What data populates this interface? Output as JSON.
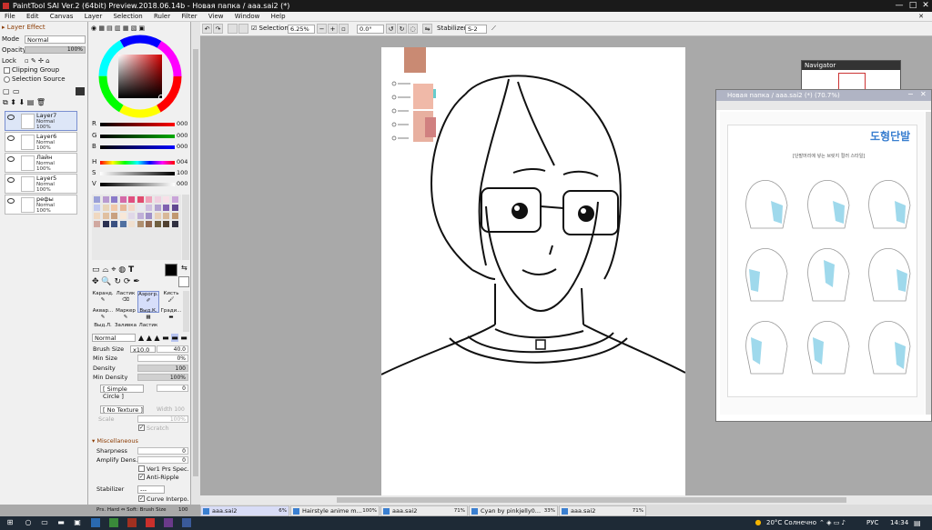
{
  "app": {
    "title": "PaintTool SAI Ver.2 (64bit) Preview.2018.06.14b - Новая папка / aaa.sai2 (*)",
    "window_buttons": [
      "—",
      "□",
      "✕"
    ]
  },
  "menu": [
    "File",
    "Edit",
    "Canvas",
    "Layer",
    "Selection",
    "Ruler",
    "Filter",
    "View",
    "Window",
    "Help"
  ],
  "layer_panel": {
    "header": "Layer Effect",
    "mode_label": "Mode",
    "mode_value": "Normal",
    "opacity_label": "Opacity",
    "opacity_value": "100%",
    "lock_label": "Lock",
    "clipping_group": "Clipping Group",
    "selection_source": "Selection Source",
    "layers": [
      {
        "name": "Layer7",
        "mode": "Normal",
        "opacity": "100%",
        "selected": true
      },
      {
        "name": "Layer6",
        "mode": "Normal",
        "opacity": "100%",
        "selected": false
      },
      {
        "name": "Лайн",
        "mode": "Normal",
        "opacity": "100%",
        "selected": false
      },
      {
        "name": "Layer5",
        "mode": "Normal",
        "opacity": "100%",
        "selected": false
      },
      {
        "name": "рефы",
        "mode": "Normal",
        "opacity": "100%",
        "selected": false
      }
    ]
  },
  "color_panel": {
    "rgb": [
      {
        "label": "R",
        "value": "000"
      },
      {
        "label": "G",
        "value": "000"
      },
      {
        "label": "B",
        "value": "000"
      }
    ],
    "hsv": [
      {
        "label": "H",
        "value": "004"
      },
      {
        "label": "S",
        "value": "100"
      },
      {
        "label": "V",
        "value": "000"
      }
    ],
    "current_color": "#000000",
    "swatches": [
      "#9aa0d8",
      "#b89ad0",
      "#8a7ac8",
      "#d46aa8",
      "#e05080",
      "#e04b6e",
      "#f0a0b8",
      "#f0d0e0",
      "#f8e0e8",
      "#c9a4d9",
      "#c0c8f0",
      "#e8d4b8",
      "#f0c8a8",
      "#e8b898",
      "#f4d8c8",
      "#e8e8f0",
      "#d0c0e0",
      "#b0a0d0",
      "#8060b0",
      "#604890",
      "#f0d8c0",
      "#e0c0a0",
      "#c8a080",
      "#f8e8d8",
      "#e0d8e8",
      "#c0b0d8",
      "#a090c8",
      "#e8d0b8",
      "#d8b898",
      "#c09870",
      "#d0a8a0",
      "#2a3050",
      "#3a5080",
      "#5070a0",
      "#f0e0d0",
      "#b09070",
      "#906850",
      "#706040",
      "#504030",
      "#303040"
    ]
  },
  "tools": {
    "brushes": [
      "Каранд.",
      "Ластик",
      "Аэрогр.",
      "Кисть",
      "Аквар...",
      "Маркер",
      "Выд.К.",
      "Гради...",
      "Выд.Л.",
      "Заливка",
      "Ластик"
    ],
    "selected_brush": "Аэрогр.",
    "blend_mode": "Normal",
    "brush_size_label": "Brush Size",
    "brush_size_mult": "x10.0",
    "brush_size_value": "40.0",
    "min_size_label": "Min Size",
    "min_size_value": "0%",
    "density_label": "Density",
    "density_value": "100",
    "min_density_label": "Min Density",
    "min_density_value": "100%",
    "shape": "[ Simple Circle ]",
    "shape_value": "0",
    "texture": "[ No Texture ]",
    "texture_width": "Width 100",
    "scale_label": "Scale",
    "scale_value": "100%",
    "scratch": "Scratch",
    "misc_header": "Miscellaneous",
    "sharpness_label": "Sharpness",
    "sharpness_value": "0",
    "amplify_label": "Amplify Dens.",
    "amplify_value": "0",
    "ver1_label": "Ver1 Prs Spec.",
    "antiripple_label": "Anti-Ripple",
    "stabilizer_label": "Stabilizer",
    "stabilizer_value": "---",
    "curve_label": "Curve Interpo.",
    "prs_text": "Prs. Hard ⇔ Soft: Brush Size",
    "prs_value": "100"
  },
  "toolbar": {
    "selection_label": "Selection",
    "zoom": "6.25%",
    "angle": "0.0°",
    "stabilizer_label": "Stabilizer",
    "stabilizer_value": "S-2"
  },
  "navigator": {
    "title": "Navigator"
  },
  "ref_window": {
    "title": "Новая папка / aaa.sai2 (*) (70.7%)",
    "ref_title": "도형단발",
    "ref_subtitle": "[단발머리에 넣는 브릿지 컬러 스타일]"
  },
  "tabs": [
    {
      "name": "aaa.sai2",
      "pct": "6%",
      "active": true
    },
    {
      "name": "Hairstyle anime m...",
      "pct": "100%",
      "active": false
    },
    {
      "name": "aaa.sai2",
      "pct": "71%",
      "active": false
    },
    {
      "name": "Cyan by pinkjelly0...",
      "pct": "33%",
      "active": false
    },
    {
      "name": "aaa.sai2",
      "pct": "71%",
      "active": false
    }
  ],
  "taskbar": {
    "weather": "20°C Солнечно",
    "lang": "РУС",
    "time": "14:34"
  }
}
